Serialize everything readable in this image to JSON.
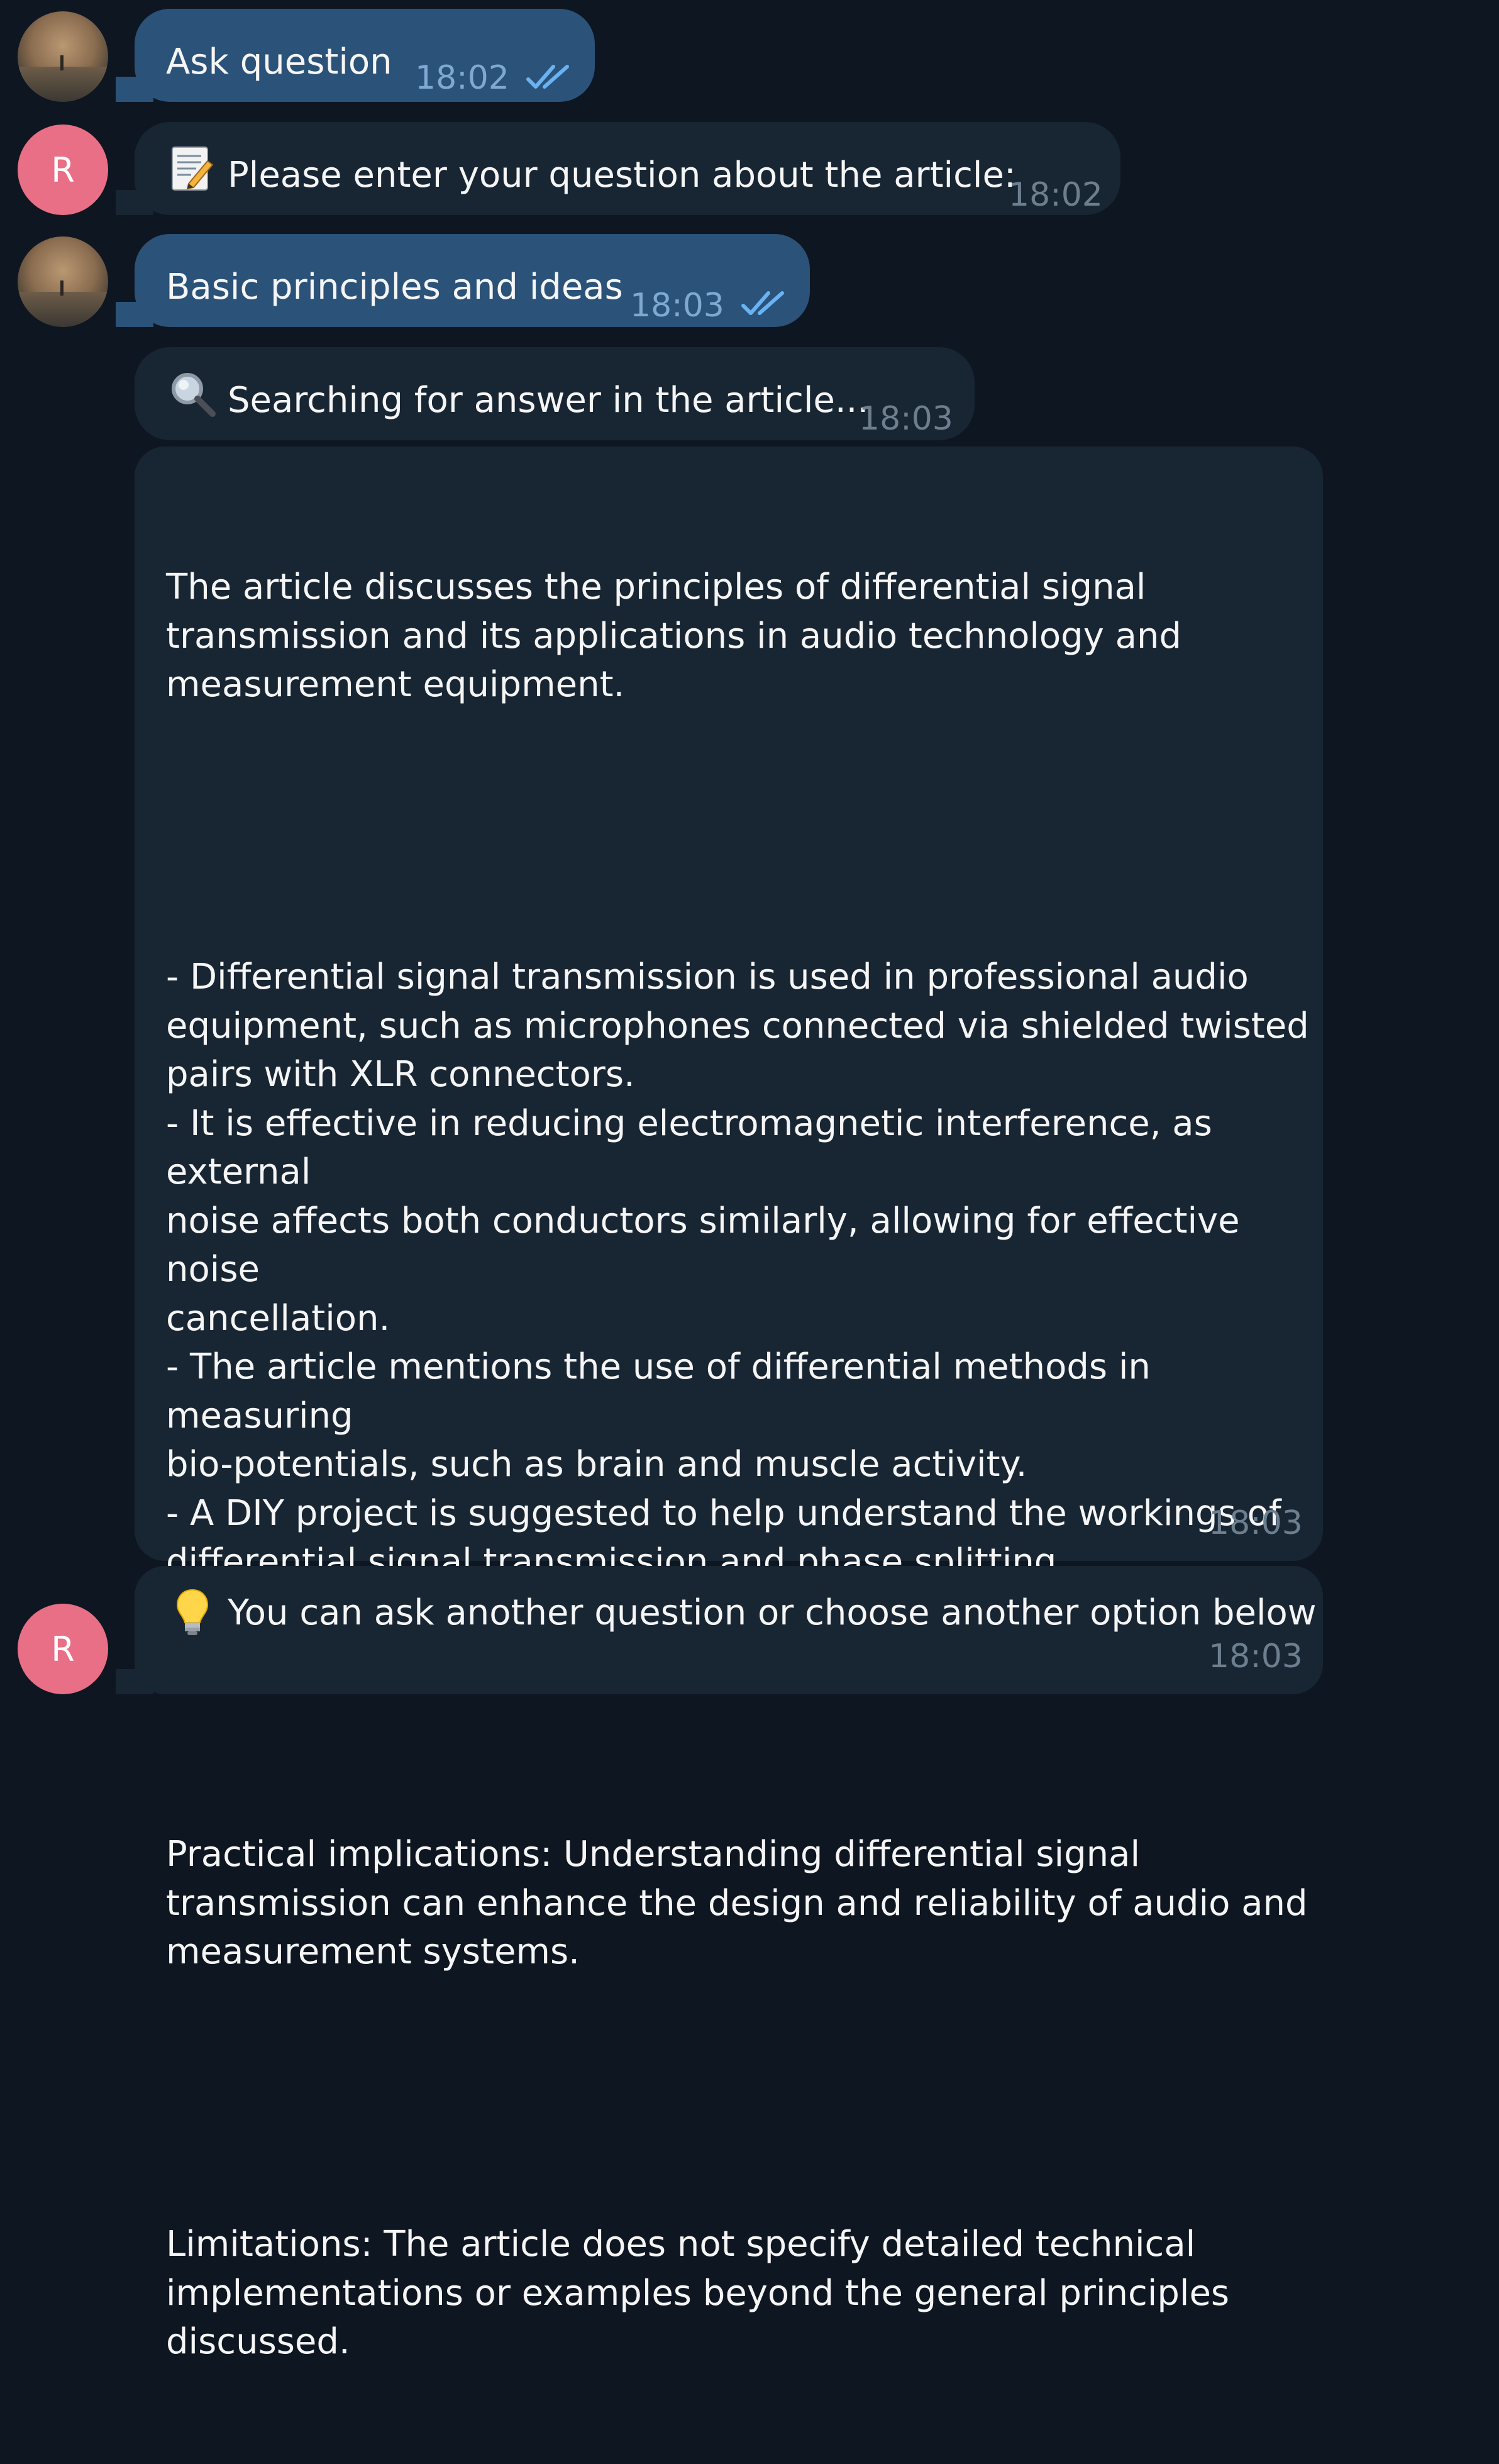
{
  "chat": {
    "messages": [
      {
        "direction": "outgoing",
        "text": "Ask question",
        "time": "18:02",
        "status": "read"
      },
      {
        "direction": "incoming",
        "sender_initial": "R",
        "text": "Please enter your question about the article:",
        "time": "18:02",
        "icon": "memo-pencil-icon"
      },
      {
        "direction": "outgoing",
        "text": "Basic principles and ideas",
        "time": "18:03",
        "status": "read"
      },
      {
        "direction": "incoming",
        "text": "Searching for answer in the article...",
        "time": "18:03",
        "icon": "magnifier-icon"
      },
      {
        "direction": "incoming",
        "paragraphs": [
          "The article discusses the principles of differential signal\ntransmission and its applications in audio technology and\nmeasurement equipment.",
          "- Differential signal transmission is used in professional audio\nequipment, such as microphones connected via shielded twisted\npairs with XLR connectors.\n- It is effective in reducing electromagnetic interference, as external\nnoise affects both conductors similarly, allowing for effective noise\ncancellation.\n- The article mentions the use of differential methods in measuring\nbio-potentials, such as brain and muscle activity.\n- A DIY project is suggested to help understand the workings of\ndifferential signal transmission and phase splitting.",
          "Practical implications: Understanding differential signal\ntransmission can enhance the design and reliability of audio and\nmeasurement systems.",
          "Limitations: The article does not specify detailed technical\nimplementations or examples beyond the general principles\ndiscussed."
        ],
        "time": "18:03"
      },
      {
        "direction": "incoming",
        "sender_initial": "R",
        "text": "You can ask another question or choose another option below",
        "time": "18:03",
        "icon": "lightbulb-icon"
      }
    ]
  },
  "colors": {
    "background": "#0e1621",
    "outgoing_bubble": "#2b5278",
    "incoming_bubble": "#182533",
    "avatar_letter": "#e96f86",
    "read_ticks": "#6ab3f3"
  }
}
